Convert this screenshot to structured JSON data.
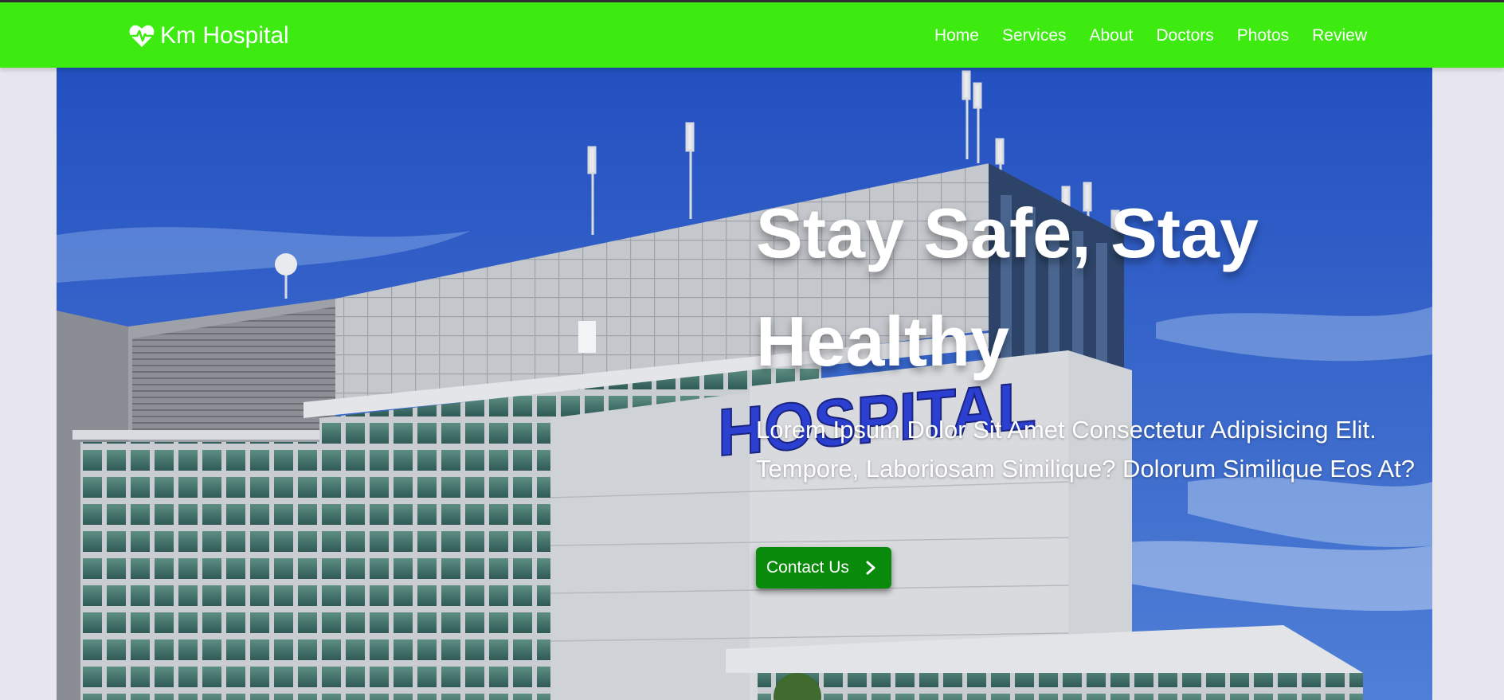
{
  "brand": {
    "name": "Km Hospital",
    "icon": "heartbeat-icon"
  },
  "nav": {
    "items": [
      {
        "label": "Home"
      },
      {
        "label": "Services"
      },
      {
        "label": "About"
      },
      {
        "label": "Doctors"
      },
      {
        "label": "Photos"
      },
      {
        "label": "Review"
      }
    ]
  },
  "hero": {
    "title": "Stay Safe, Stay Healthy",
    "text": "Lorem Ipsum Dolor Sit Amet Consectetur Adipisicing Elit. Tempore, Laboriosam Similique? Dolorum Similique Eos At?",
    "cta_label": "Contact Us",
    "cta_icon": "chevron-right-icon",
    "building_sign": "HOSPITAL"
  },
  "colors": {
    "navbar": "#3deb10",
    "cta": "#0a8a0a",
    "sky": "#2c57c4",
    "page_bg": "#e7e6ee"
  }
}
